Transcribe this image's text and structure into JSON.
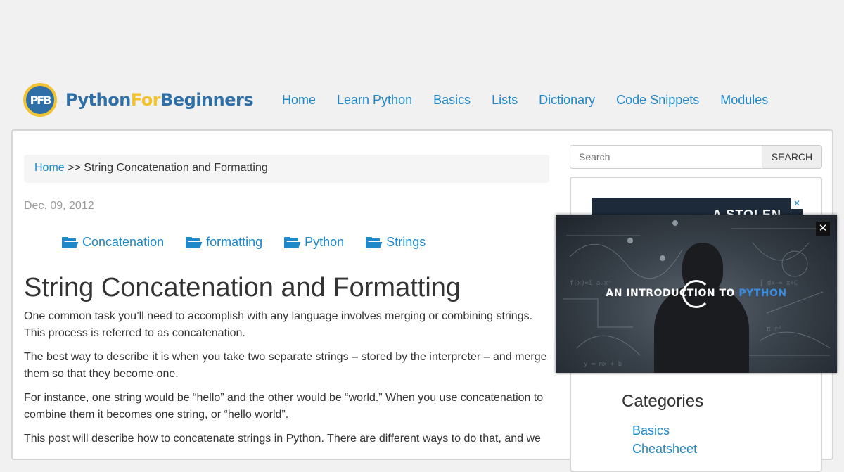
{
  "logo": {
    "badge": "PFB",
    "part1": "Python",
    "part2": "For",
    "part3": "Beginners"
  },
  "nav": [
    "Home",
    "Learn Python",
    "Basics",
    "Lists",
    "Dictionary",
    "Code Snippets",
    "Modules"
  ],
  "breadcrumb": {
    "home": "Home",
    "separator": ">>",
    "current": "String Concatenation and Formatting"
  },
  "post": {
    "date": "Dec. 09, 2012",
    "tags": [
      "Concatenation",
      "formatting",
      "Python",
      "Strings"
    ],
    "title": "String Concatenation and Formatting",
    "paragraphs": [
      "One common task you’ll need to accomplish with any language involves merging or combining strings. This process is referred to as concatenation.",
      "The best way to describe it is when you take two separate strings – stored by the interpreter – and merge them so that they become one.",
      "For instance, one string would be “hello” and the other would be “world.” When you use concatenation to combine them it becomes one string, or “hello world”.",
      "This post will describe how to concatenate strings in Python. There are different ways to do that, and we"
    ]
  },
  "search": {
    "placeholder": "Search",
    "button": "SEARCH"
  },
  "ad": {
    "text": "A STOLEN",
    "close": "✕"
  },
  "video": {
    "title_prefix": "AN INTRODUCTION TO",
    "title_accent": "PYTHON",
    "close": "✕"
  },
  "sidebar": {
    "categories_title": "Categories",
    "categories": [
      "Basics",
      "Cheatsheet"
    ]
  }
}
